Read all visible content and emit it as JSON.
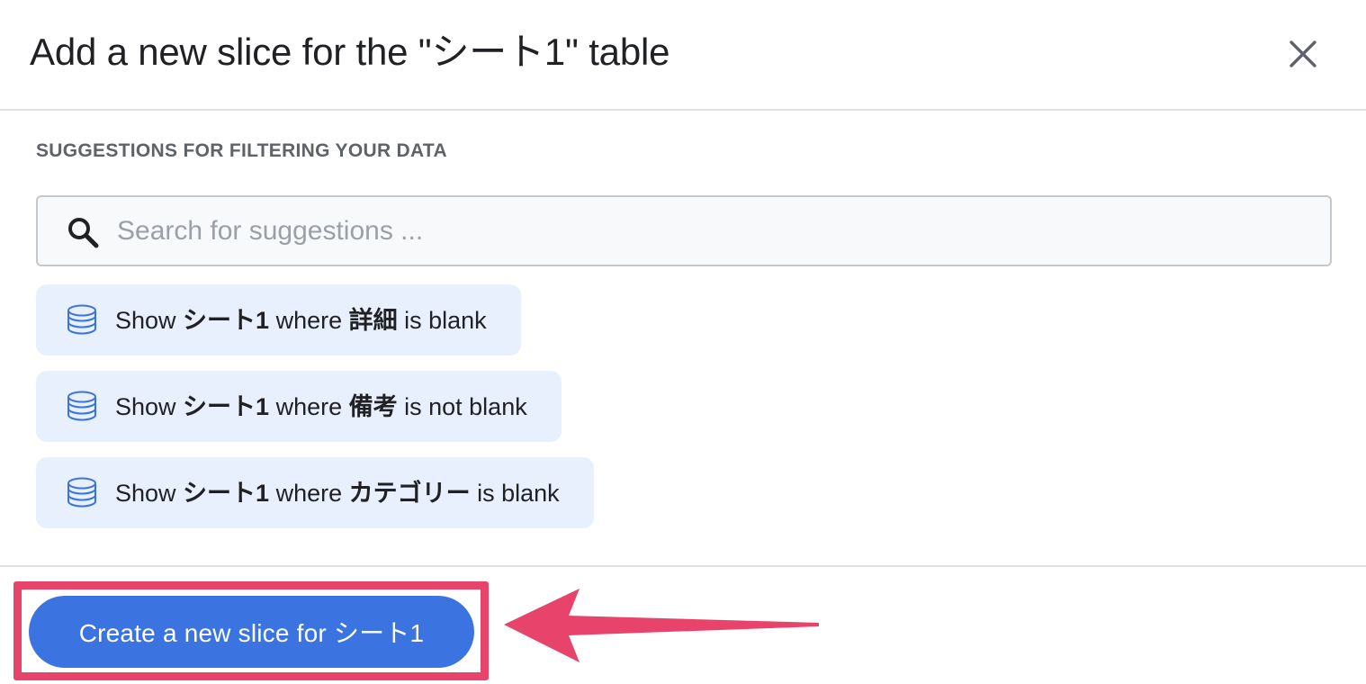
{
  "dialog": {
    "title": "Add a new slice for the \"シート1\" table",
    "close_icon": "close-icon"
  },
  "suggestions": {
    "section_title": "SUGGESTIONS FOR FILTERING YOUR DATA",
    "search": {
      "placeholder": "Search for suggestions ...",
      "value": "",
      "icon": "search-icon"
    },
    "items": [
      {
        "prefix": "Show ",
        "table": "シート1",
        "mid": " where ",
        "column": "詳細",
        "suffix": " is blank",
        "icon": "database-icon"
      },
      {
        "prefix": "Show ",
        "table": "シート1",
        "mid": " where ",
        "column": "備考",
        "suffix": " is not blank",
        "icon": "database-icon"
      },
      {
        "prefix": "Show ",
        "table": "シート1",
        "mid": " where ",
        "column": "カテゴリー",
        "suffix": " is blank",
        "icon": "database-icon"
      }
    ]
  },
  "footer": {
    "create_button_label": "Create a new slice for シート1"
  },
  "colors": {
    "primary": "#3b74e0",
    "chip_background": "#e8f0fe",
    "annotation": "#e8436a"
  }
}
